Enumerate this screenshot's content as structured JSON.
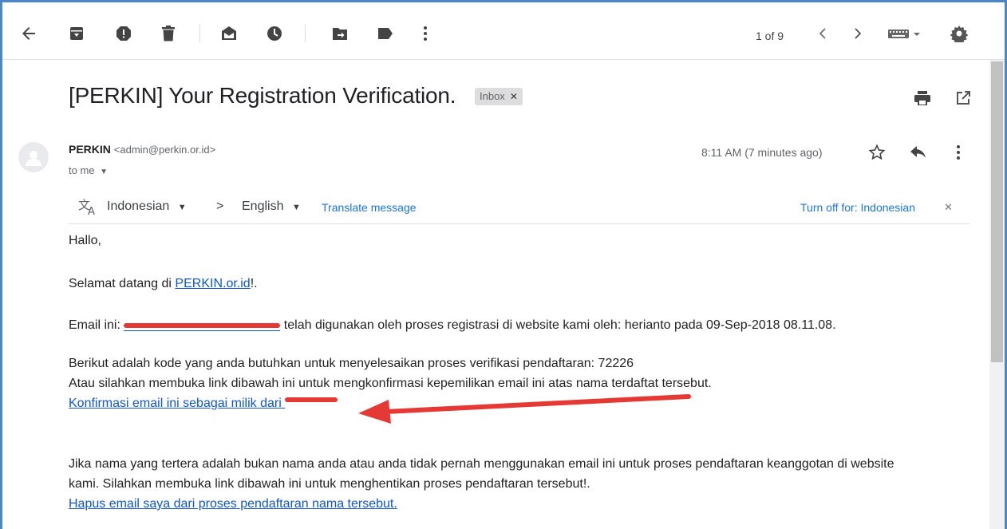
{
  "toolbar": {
    "pager": "1 of 9"
  },
  "email": {
    "subject": "[PERKIN] Your Registration Verification.",
    "label": "Inbox",
    "sender_name": "PERKIN",
    "sender_email": "<admin@perkin.or.id>",
    "recipient": "to me",
    "time": "8:11 AM (7 minutes ago)"
  },
  "translate": {
    "source_lang": "Indonesian",
    "target_lang": "English",
    "translate_link": "Translate message",
    "turn_off": "Turn off for: Indonesian"
  },
  "body": {
    "greeting": "Hallo,",
    "welcome_prefix": "Selamat datang di ",
    "welcome_link": "PERKIN.or.id",
    "welcome_suffix": "!.",
    "email_prefix": "Email ini: ",
    "email_suffix": " telah digunakan oleh proses registrasi di website kami oleh: herianto pada 09-Sep-2018 08.11.08.",
    "code_line": "Berikut adalah kode yang anda butuhkan untuk menyelesaikan proses verifikasi pendaftaran: 72226",
    "confirm_instruction": "Atau silahkan membuka link dibawah ini untuk mengkonfirmasi kepemilikan email ini atas nama terdaftat tersebut.",
    "confirm_link": "Konfirmasi email ini sebagai milik dari ",
    "notice_line1": "Jika nama yang tertera adalah bukan nama anda atau anda tidak pernah menggunakan email ini untuk proses pendaftaran keanggotan di website",
    "notice_line2": "kami. Silahkan membuka link dibawah ini untuk menghentikan proses pendaftaran tersebut!.",
    "delete_link": "Hapus email saya dari proses pendaftaran nama tersebut."
  },
  "colors": {
    "frame": "#4a86c8",
    "link": "#1155cc",
    "annotation": "#e53935"
  }
}
